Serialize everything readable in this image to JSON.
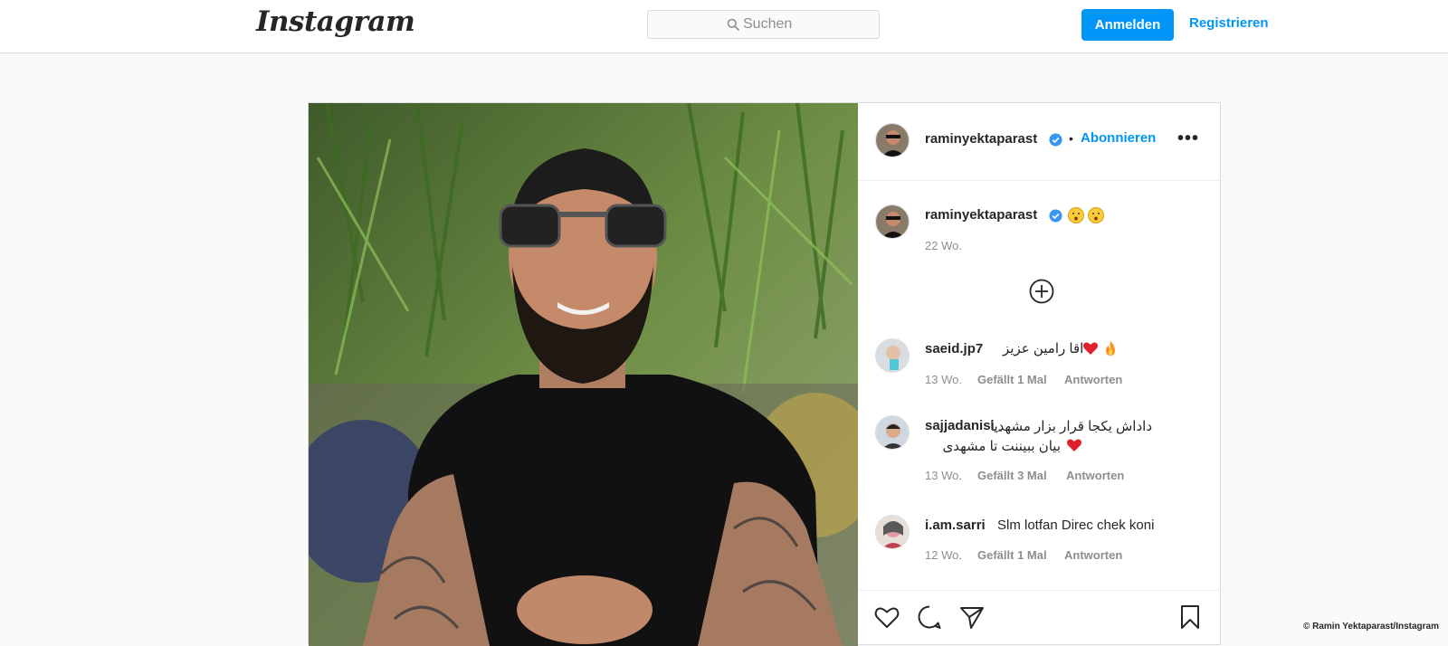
{
  "header": {
    "logo": "Instagram",
    "search_placeholder": "Suchen",
    "login_label": "Anmelden",
    "register_label": "Registrieren"
  },
  "post": {
    "author": "raminyektaparast",
    "follow_label": "Abonnieren",
    "separator": "•",
    "more_label": "•••",
    "caption_user": "raminyektaparast",
    "caption_age": "22 Wo.",
    "comments": [
      {
        "user": "saeid.jp7",
        "text": "اقا رامین عزیز",
        "age": "13 Wo.",
        "likes": "Gefällt 1 Mal",
        "reply": "Antworten"
      },
      {
        "user": "sajjadanisi_",
        "text": "داداش یکجا قرار بزار مشهدیا",
        "text2": "بیان ببیننت تا مشهدی",
        "age": "13 Wo.",
        "likes": "Gefällt 3 Mal",
        "reply": "Antworten"
      },
      {
        "user": "i.am.sarri",
        "text": "Slm lotfan Direc chek koni",
        "age": "12 Wo.",
        "likes": "Gefällt 1 Mal",
        "reply": "Antworten"
      }
    ]
  },
  "credit": "© Ramin Yektaparast/Instagram",
  "icons": [
    "search-icon",
    "verified-icon",
    "more-icon",
    "load-more-icon",
    "heart-icon",
    "comment-icon",
    "share-icon",
    "bookmark-icon",
    "fire-icon",
    "heart-emoji-icon",
    "sad-face-icon"
  ],
  "colors": {
    "accent": "#0095f6",
    "text": "#262626",
    "muted": "#8e8e8e",
    "border": "#dbdbdb"
  }
}
